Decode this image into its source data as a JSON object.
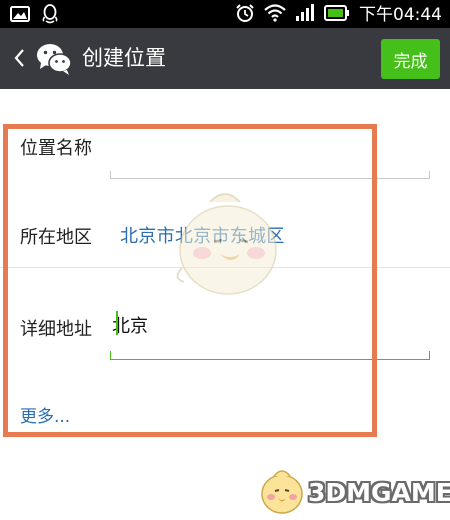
{
  "status_bar": {
    "time": "下午04:44",
    "icons": [
      "gallery-icon",
      "qq-icon",
      "alarm-icon",
      "wifi-icon",
      "signal-icon",
      "battery-icon"
    ]
  },
  "title_bar": {
    "title": "创建位置",
    "done_label": "完成",
    "accent_color": "#45c01a",
    "bg_color": "#393a3f"
  },
  "form": {
    "name_label": "位置名称",
    "name_value": "",
    "region_label": "所在地区",
    "region_value": "北京市北京市东城区",
    "address_label": "详细地址",
    "address_value": "北京",
    "more_label": "更多..."
  },
  "watermark": {
    "text": "3DMGAME"
  },
  "highlight_color": "#e87a52"
}
